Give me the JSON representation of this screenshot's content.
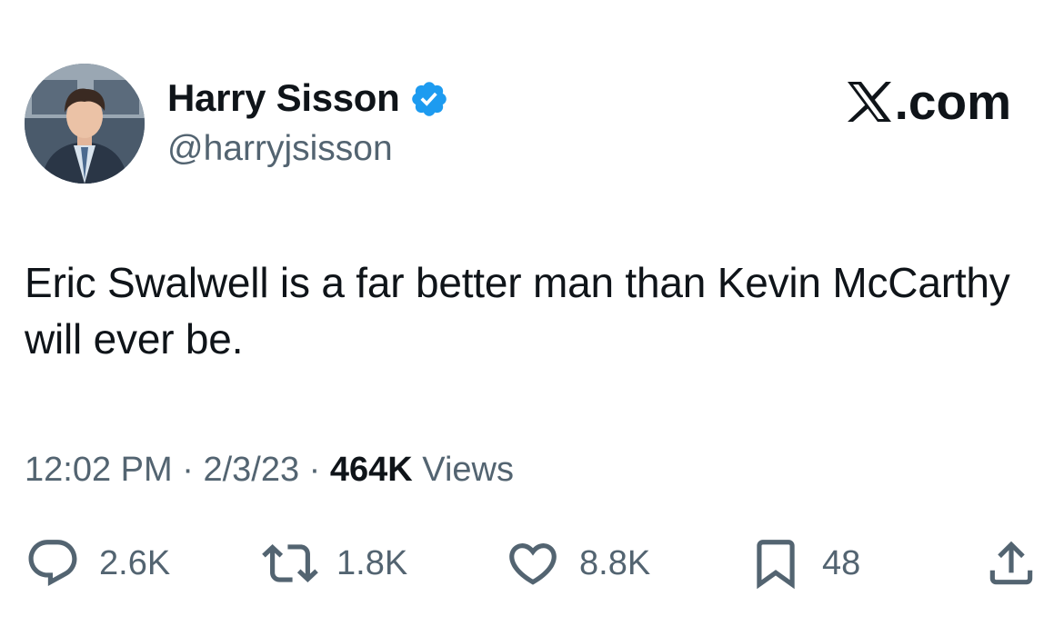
{
  "author": {
    "display_name": "Harry Sisson",
    "handle": "@harryjsisson",
    "verified": true,
    "verified_color": "#1d9bf0"
  },
  "brand": {
    "label": ".com",
    "logo_icon": "x-logo-icon"
  },
  "tweet": {
    "text": "Eric Swalwell is a far better man than Kevin McCarthy will ever be.",
    "time": "12:02 PM",
    "date": "2/3/23",
    "separator": "·",
    "views_count": "464K",
    "views_label": "Views"
  },
  "actions": {
    "reply": {
      "icon": "reply-icon",
      "count": "2.6K"
    },
    "retweet": {
      "icon": "retweet-icon",
      "count": "1.8K"
    },
    "like": {
      "icon": "heart-icon",
      "count": "8.8K"
    },
    "bookmark": {
      "icon": "bookmark-icon",
      "count": "48"
    },
    "share": {
      "icon": "share-icon"
    }
  },
  "colors": {
    "text_primary": "#0f1419",
    "text_secondary": "#536471",
    "background": "#ffffff"
  }
}
